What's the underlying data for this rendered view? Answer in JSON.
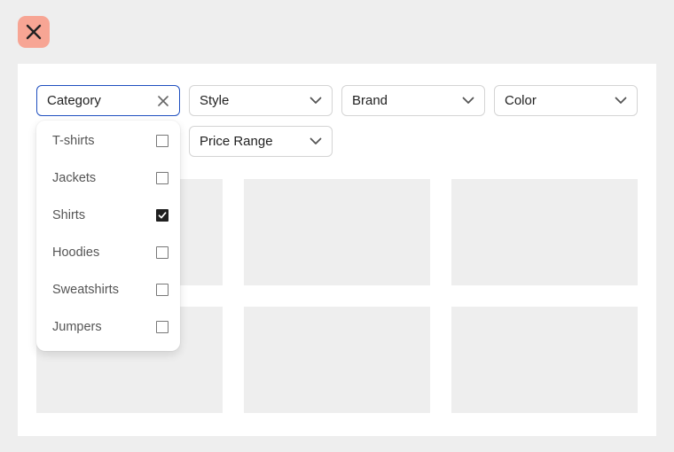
{
  "filters": {
    "category": {
      "label": "Category"
    },
    "style": {
      "label": "Style"
    },
    "brand": {
      "label": "Brand"
    },
    "color": {
      "label": "Color"
    },
    "price_range": {
      "label": "Price Range"
    }
  },
  "category_options": [
    {
      "label": "T-shirts",
      "checked": false
    },
    {
      "label": "Jackets",
      "checked": false
    },
    {
      "label": "Shirts",
      "checked": true
    },
    {
      "label": "Hoodies",
      "checked": false
    },
    {
      "label": "Sweatshirts",
      "checked": false
    },
    {
      "label": "Jumpers",
      "checked": false
    }
  ],
  "colors": {
    "close_button_bg": "#f7a594",
    "active_border": "#1f4fbf",
    "checkbox_checked": "#1f1f1f",
    "tile_placeholder": "#eeeeee"
  },
  "icons": {
    "close": "close-icon",
    "clear": "clear-icon",
    "dropdown": "chevron-down-icon",
    "check": "check-icon"
  }
}
